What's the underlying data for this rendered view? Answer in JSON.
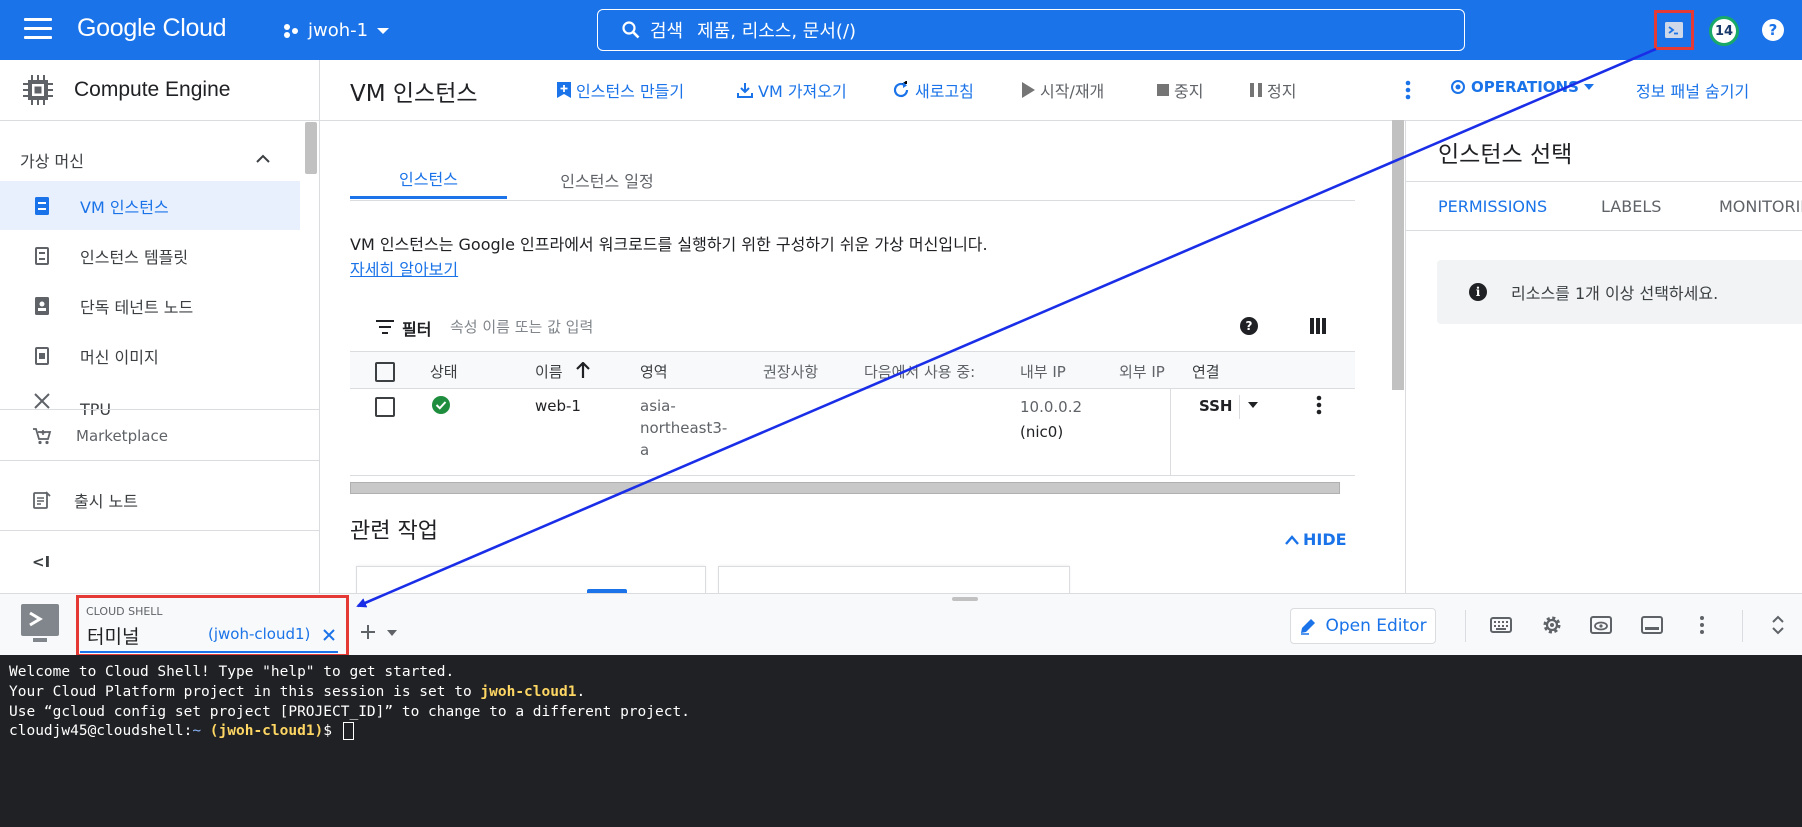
{
  "topbar": {
    "logo": "Google Cloud",
    "project": "jwoh-1",
    "search_label": "검색",
    "search_placeholder": "제품, 리소스, 문서(/)",
    "notification_count": "14",
    "help": "?"
  },
  "leftnav": {
    "product": "Compute Engine",
    "section": "가상 머신",
    "items": [
      {
        "label": "VM 인스턴스",
        "icon": "vm-instance-icon"
      },
      {
        "label": "인스턴스 템플릿",
        "icon": "template-icon"
      },
      {
        "label": "단독 테넌트 노드",
        "icon": "sole-tenant-icon"
      },
      {
        "label": "머신 이미지",
        "icon": "machine-image-icon"
      },
      {
        "label": "TPU",
        "icon": "tpu-icon"
      }
    ],
    "marketplace": "Marketplace",
    "release_notes": "출시 노트",
    "collapse": "<I"
  },
  "main": {
    "title": "VM 인스턴스",
    "actions": {
      "create": "인스턴스 만들기",
      "import": "VM 가져오기",
      "refresh": "새로고침",
      "start": "시작/재개",
      "stop": "중지",
      "suspend": "정지",
      "operations": "OPERATIONS",
      "hide_panel": "정보 패널 숨기기"
    },
    "tabs": [
      "인스턴스",
      "인스턴스 일정"
    ],
    "description": "VM 인스턴스는 Google 인프라에서 워크로드를 실행하기 위한 구성하기 쉬운 가상 머신입니다.",
    "learn_more": "자세히 알아보기",
    "filter_label": "필터",
    "filter_placeholder": "속성 이름 또는 값 입력",
    "columns": [
      "상태",
      "이름",
      "영역",
      "권장사항",
      "다음에서 사용 중:",
      "내부 IP",
      "외부 IP",
      "연결"
    ],
    "row": {
      "name": "web-1",
      "zone_lines": [
        "asia-",
        "northeast3-",
        "a"
      ],
      "internal_ip": "10.0.0.2",
      "nic": "(nic0)",
      "connect": "SSH"
    },
    "related": "관련 작업",
    "hide": "HIDE"
  },
  "rpanel": {
    "title": "인스턴스 선택",
    "tabs": [
      "PERMISSIONS",
      "LABELS",
      "MONITORING"
    ],
    "message": "리소스를 1개 이상 선택하세요."
  },
  "shell": {
    "label": "CLOUD SHELL",
    "tab_name": "터미널",
    "tab_project": "(jwoh-cloud1)",
    "open_editor": "Open Editor"
  },
  "terminal": {
    "line1": "Welcome to Cloud Shell! Type \"help\" to get started.",
    "line2_a": "Your Cloud Platform project in this session is set to ",
    "line2_b": "jwoh-cloud1",
    "line2_c": ".",
    "line3": "Use “gcloud config set project [PROJECT_ID]” to change to a different project.",
    "prompt_a": "cloudjw45@cloudshell:",
    "prompt_b": "~ ",
    "prompt_c": "(jwoh-cloud1)",
    "prompt_d": "$ "
  },
  "colors": {
    "brand_blue": "#1a73e8",
    "annotation_red": "#e53935",
    "annotation_arrow": "#1a2ee8",
    "terminal_bg": "#202124",
    "terminal_highlight": "#fdd663",
    "status_green": "#1e8e3e"
  }
}
